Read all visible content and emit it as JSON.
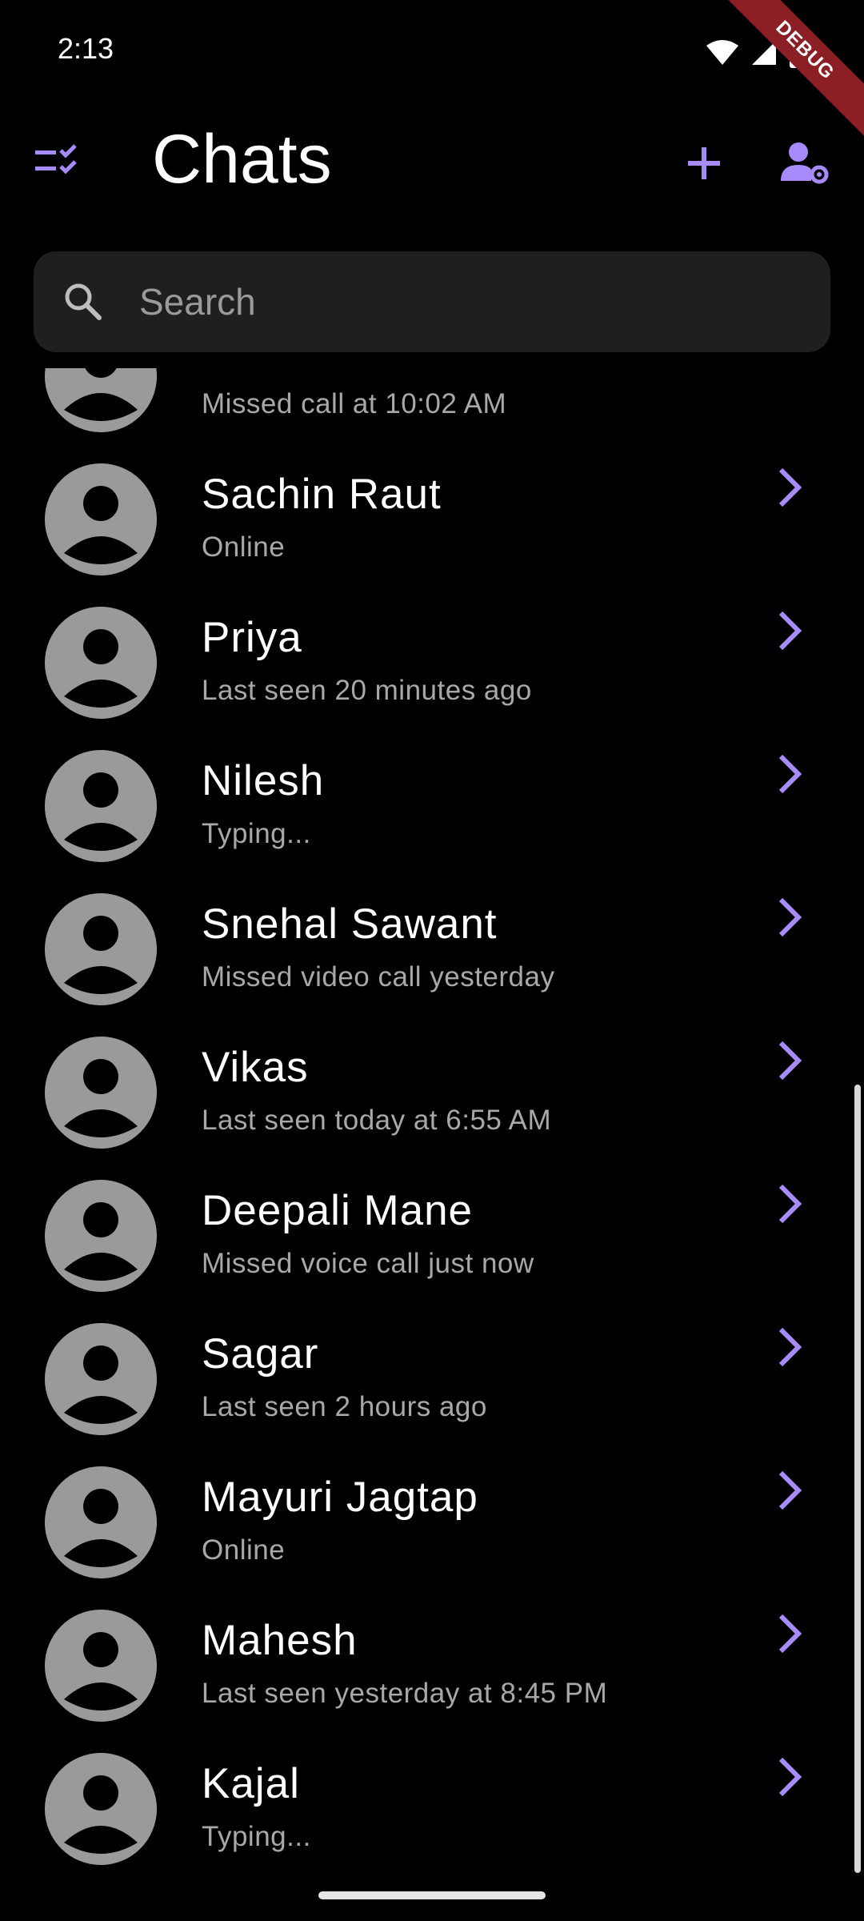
{
  "status_bar": {
    "time": "2:13",
    "debug_label": "DEBUG"
  },
  "app_bar": {
    "title": "Chats",
    "accent_color": "#a78bfa"
  },
  "search": {
    "placeholder": "Search",
    "value": ""
  },
  "chats": [
    {
      "name": "",
      "status": "Missed call at 10:02 AM"
    },
    {
      "name": "Sachin Raut",
      "status": "Online"
    },
    {
      "name": "Priya",
      "status": "Last seen 20 minutes ago"
    },
    {
      "name": "Nilesh",
      "status": "Typing..."
    },
    {
      "name": "Snehal Sawant",
      "status": "Missed video call yesterday"
    },
    {
      "name": "Vikas",
      "status": "Last seen today at 6:55 AM"
    },
    {
      "name": "Deepali Mane",
      "status": "Missed voice call just now"
    },
    {
      "name": "Sagar",
      "status": "Last seen 2 hours ago"
    },
    {
      "name": "Mayuri Jagtap",
      "status": "Online"
    },
    {
      "name": "Mahesh",
      "status": "Last seen yesterday at 8:45 PM"
    },
    {
      "name": "Kajal",
      "status": "Typing..."
    }
  ],
  "icons": {
    "left": "checklist-icon",
    "add": "add-icon",
    "settings": "user-settings-icon",
    "search": "search-icon",
    "chevron": "chevron-right-icon",
    "avatar": "person-placeholder-icon"
  }
}
